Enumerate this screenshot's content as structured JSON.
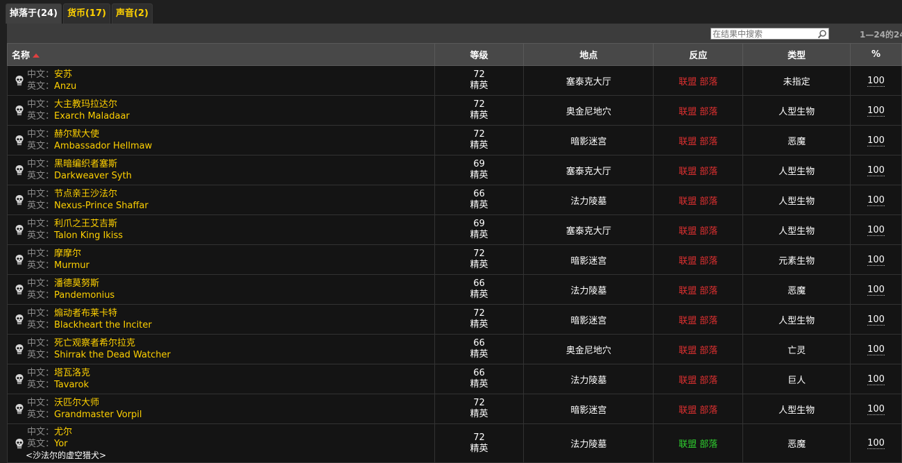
{
  "tabs": [
    {
      "label": "掉落于(24)",
      "active": true
    },
    {
      "label": "货币(17)",
      "active": false
    },
    {
      "label": "声音(2)",
      "active": false
    }
  ],
  "search": {
    "placeholder": "在结果中搜索"
  },
  "result_count": "1—24的24",
  "columns": {
    "name": "名称",
    "level": "等级",
    "location": "地点",
    "reaction": "反应",
    "type": "类型",
    "percent": "%"
  },
  "labels": {
    "cn": "中文：",
    "en": "英文："
  },
  "colors": {
    "hostile": "#e03030",
    "friendly": "#2fd12f",
    "name_value": "#ffd100"
  },
  "icon": "skull-icon",
  "rows": [
    {
      "cn": "安苏",
      "en": "Anzu",
      "level": "72",
      "rank": "精英",
      "location": "塞泰克大厅",
      "alliance": "联盟",
      "horde": "部落",
      "reaction": "hostile",
      "type": "未指定",
      "percent": "100"
    },
    {
      "cn": "大主教玛拉达尔",
      "en": "Exarch Maladaar",
      "level": "72",
      "rank": "精英",
      "location": "奥金尼地穴",
      "alliance": "联盟",
      "horde": "部落",
      "reaction": "hostile",
      "type": "人型生物",
      "percent": "100"
    },
    {
      "cn": "赫尔默大使",
      "en": "Ambassador Hellmaw",
      "level": "72",
      "rank": "精英",
      "location": "暗影迷宫",
      "alliance": "联盟",
      "horde": "部落",
      "reaction": "hostile",
      "type": "恶魔",
      "percent": "100"
    },
    {
      "cn": "黑暗编织者塞斯",
      "en": "Darkweaver Syth",
      "level": "69",
      "rank": "精英",
      "location": "塞泰克大厅",
      "alliance": "联盟",
      "horde": "部落",
      "reaction": "hostile",
      "type": "人型生物",
      "percent": "100"
    },
    {
      "cn": "节点亲王沙法尔",
      "en": "Nexus-Prince Shaffar",
      "level": "66",
      "rank": "精英",
      "location": "法力陵墓",
      "alliance": "联盟",
      "horde": "部落",
      "reaction": "hostile",
      "type": "人型生物",
      "percent": "100"
    },
    {
      "cn": "利爪之王艾吉斯",
      "en": "Talon King Ikiss",
      "level": "69",
      "rank": "精英",
      "location": "塞泰克大厅",
      "alliance": "联盟",
      "horde": "部落",
      "reaction": "hostile",
      "type": "人型生物",
      "percent": "100"
    },
    {
      "cn": "摩摩尔",
      "en": "Murmur",
      "level": "72",
      "rank": "精英",
      "location": "暗影迷宫",
      "alliance": "联盟",
      "horde": "部落",
      "reaction": "hostile",
      "type": "元素生物",
      "percent": "100"
    },
    {
      "cn": "潘德莫努斯",
      "en": "Pandemonius",
      "level": "66",
      "rank": "精英",
      "location": "法力陵墓",
      "alliance": "联盟",
      "horde": "部落",
      "reaction": "hostile",
      "type": "恶魔",
      "percent": "100"
    },
    {
      "cn": "煽动者布莱卡特",
      "en": "Blackheart the Inciter",
      "level": "72",
      "rank": "精英",
      "location": "暗影迷宫",
      "alliance": "联盟",
      "horde": "部落",
      "reaction": "hostile",
      "type": "人型生物",
      "percent": "100"
    },
    {
      "cn": "死亡观察者希尔拉克",
      "en": "Shirrak the Dead Watcher",
      "level": "66",
      "rank": "精英",
      "location": "奥金尼地穴",
      "alliance": "联盟",
      "horde": "部落",
      "reaction": "hostile",
      "type": "亡灵",
      "percent": "100"
    },
    {
      "cn": "塔瓦洛克",
      "en": "Tavarok",
      "level": "66",
      "rank": "精英",
      "location": "法力陵墓",
      "alliance": "联盟",
      "horde": "部落",
      "reaction": "hostile",
      "type": "巨人",
      "percent": "100"
    },
    {
      "cn": "沃匹尔大师",
      "en": "Grandmaster Vorpil",
      "level": "72",
      "rank": "精英",
      "location": "暗影迷宫",
      "alliance": "联盟",
      "horde": "部落",
      "reaction": "hostile",
      "type": "人型生物",
      "percent": "100"
    },
    {
      "cn": "尤尔",
      "en": "Yor",
      "title": "<沙法尔的虚空猎犬>",
      "level": "72",
      "rank": "精英",
      "location": "法力陵墓",
      "alliance": "联盟",
      "horde": "部落",
      "reaction": "friendly",
      "type": "恶魔",
      "percent": "100"
    }
  ]
}
